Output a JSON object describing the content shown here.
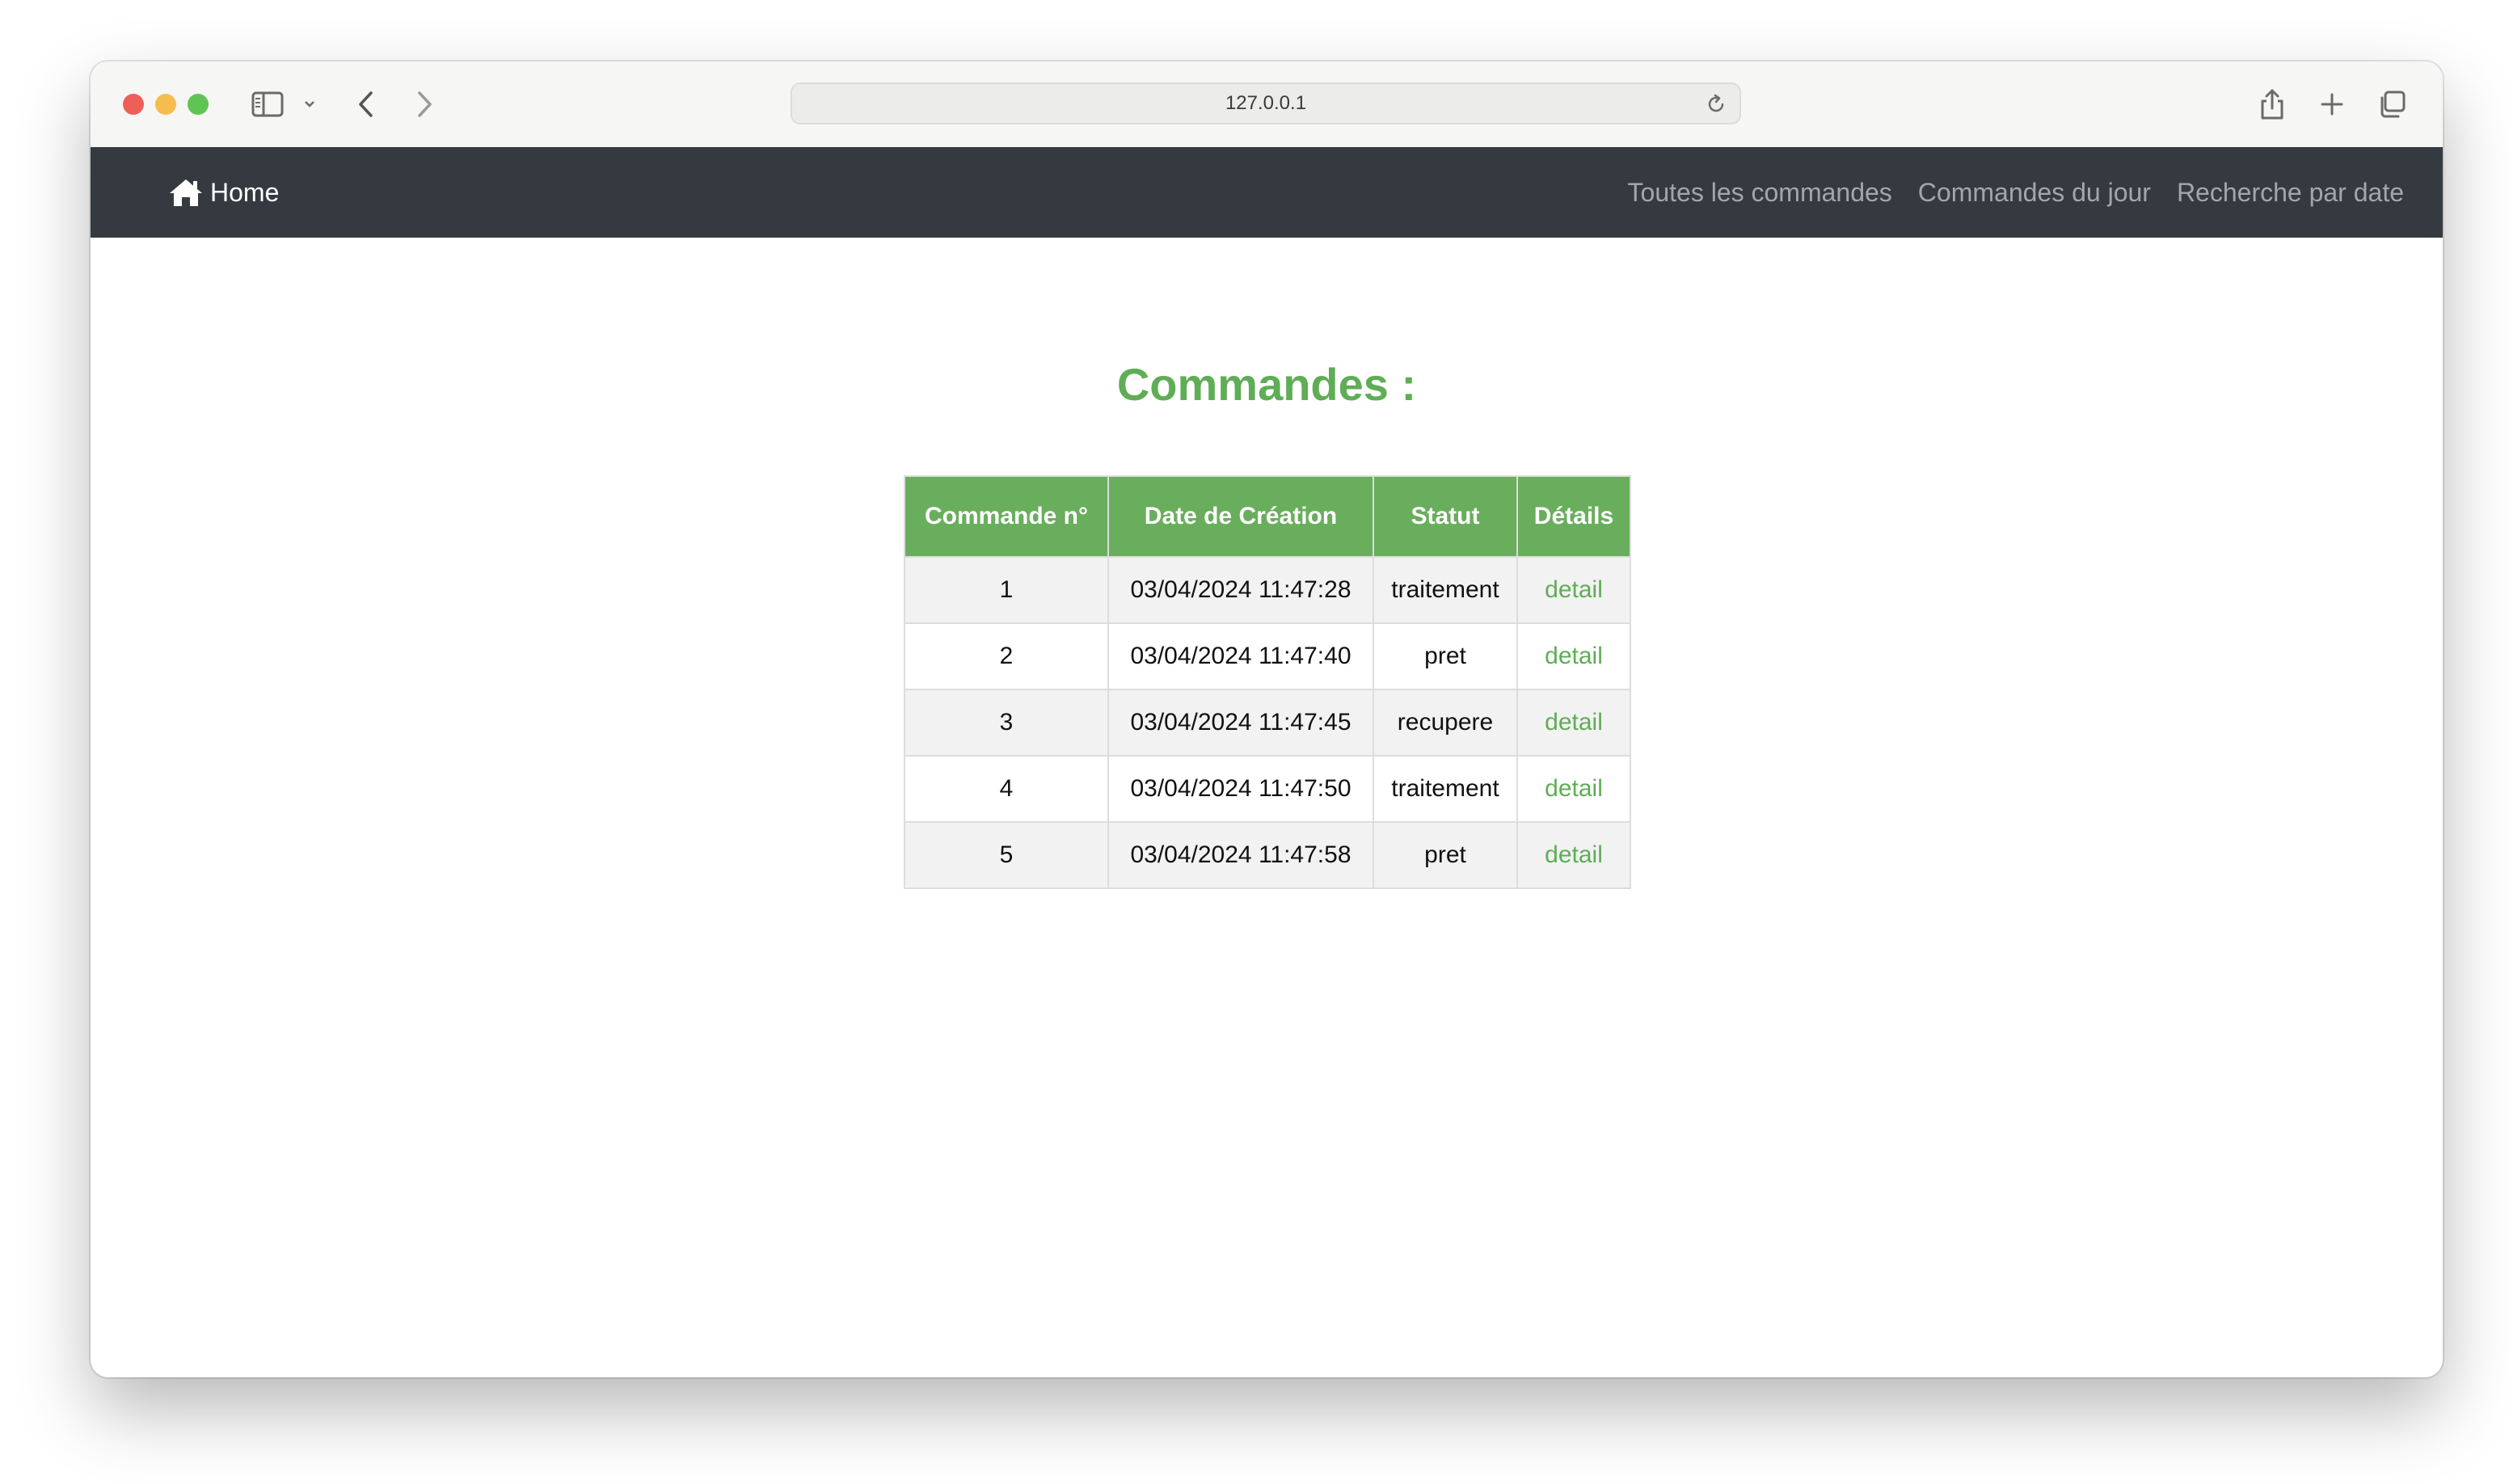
{
  "browser": {
    "url": "127.0.0.1",
    "icons": {
      "sidebar": "sidebar-icon",
      "chevron": "chevron-down-icon",
      "back": "back-arrow-icon",
      "forward": "forward-arrow-icon",
      "reload": "reload-icon",
      "share": "share-icon",
      "new_tab": "plus-icon",
      "tabs": "tabs-overview-icon"
    }
  },
  "navbar": {
    "brand_label": "Home",
    "brand_icon": "home-icon",
    "links": [
      {
        "label": "Toutes les commandes"
      },
      {
        "label": "Commandes du jour"
      },
      {
        "label": "Recherche par date"
      }
    ]
  },
  "page": {
    "title": "Commandes :"
  },
  "table": {
    "headers": [
      "Commande n°",
      "Date de Création",
      "Statut",
      "Détails"
    ],
    "rows": [
      {
        "num": "1",
        "date": "03/04/2024 11:47:28",
        "status": "traitement",
        "detail": "detail"
      },
      {
        "num": "2",
        "date": "03/04/2024 11:47:40",
        "status": "pret",
        "detail": "detail"
      },
      {
        "num": "3",
        "date": "03/04/2024 11:47:45",
        "status": "recupere",
        "detail": "detail"
      },
      {
        "num": "4",
        "date": "03/04/2024 11:47:50",
        "status": "traitement",
        "detail": "detail"
      },
      {
        "num": "5",
        "date": "03/04/2024 11:47:58",
        "status": "pret",
        "detail": "detail"
      }
    ]
  },
  "colors": {
    "navbar_bg": "#343a40",
    "accent_green": "#5fad56",
    "header_green": "#69ae5c",
    "row_stripe": "#f2f2f2"
  }
}
